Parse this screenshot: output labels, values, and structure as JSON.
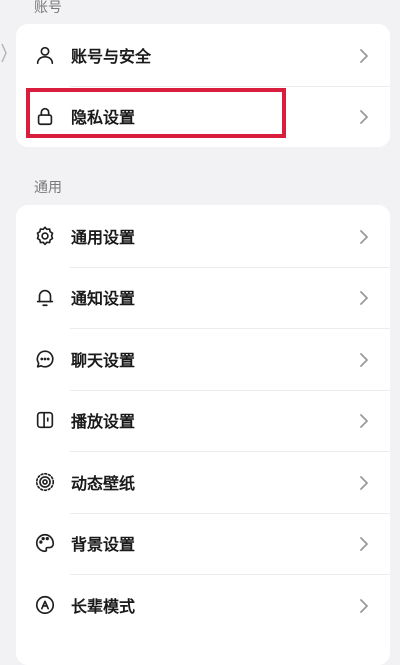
{
  "sections": {
    "account": {
      "header": "账号",
      "items": [
        {
          "label": "账号与安全",
          "icon": "user-icon"
        },
        {
          "label": "隐私设置",
          "icon": "lock-icon"
        }
      ]
    },
    "general": {
      "header": "通用",
      "items": [
        {
          "label": "通用设置",
          "icon": "gear-icon"
        },
        {
          "label": "通知设置",
          "icon": "bell-icon"
        },
        {
          "label": "聊天设置",
          "icon": "chat-bubble-icon"
        },
        {
          "label": "播放设置",
          "icon": "play-device-icon"
        },
        {
          "label": "动态壁纸",
          "icon": "live-wallpaper-icon"
        },
        {
          "label": "背景设置",
          "icon": "palette-icon"
        },
        {
          "label": "长辈模式",
          "icon": "elder-mode-icon"
        }
      ]
    }
  },
  "colors": {
    "background": "#f2f2f4",
    "card": "#ffffff",
    "highlight": "#d81e3c",
    "chevron": "#9a9a9a"
  }
}
